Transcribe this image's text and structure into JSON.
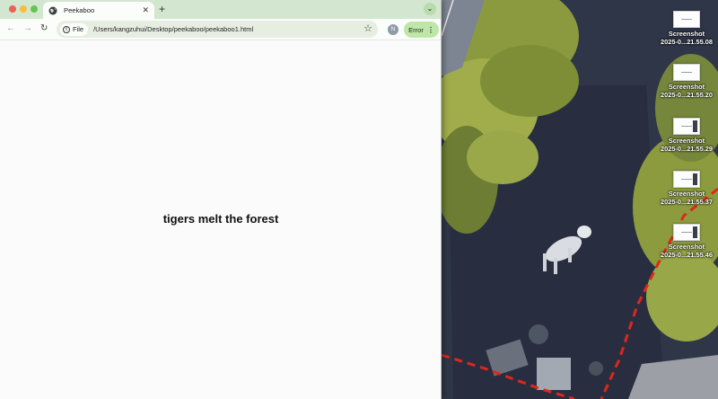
{
  "browser": {
    "tab": {
      "title": "Peekaboo",
      "favicon": "globe-icon"
    },
    "new_tab_label": "+",
    "address_bar": {
      "scheme_chip": "File",
      "url": "/Users/kangzuhui/Desktop/peekaboo/peekaboo1.html"
    },
    "profile_initial": "N",
    "error_button_label": "Error"
  },
  "page": {
    "text": "tigers melt the forest"
  },
  "desktop": {
    "files": [
      {
        "line1": "Screenshot",
        "line2": "2025-0...21.55.08"
      },
      {
        "line1": "Screenshot",
        "line2": "2025-0...21.55.20"
      },
      {
        "line1": "Screenshot",
        "line2": "2025-0...21.55.29"
      },
      {
        "line1": "Screenshot",
        "line2": "2025-0...21.55.37"
      },
      {
        "line1": "Screenshot",
        "line2": "2025-0...21.55.46"
      }
    ]
  },
  "colors": {
    "tabbar_bg": "#d3e6cf",
    "error_button_bg": "#bfe6a9",
    "close": "#ee5f57",
    "minimize": "#f6bd3e",
    "maximize": "#62c655",
    "boundary_dash": "#e0261c"
  }
}
